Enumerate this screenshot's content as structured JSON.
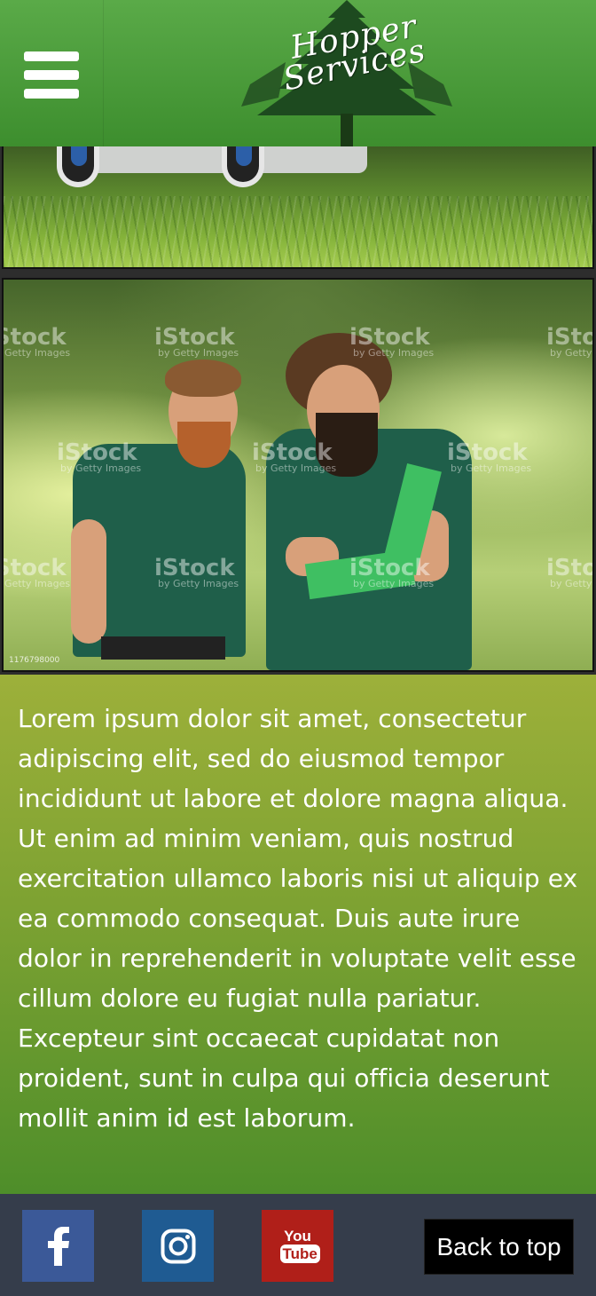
{
  "header": {
    "menu_icon": "hamburger-menu-icon",
    "logo": {
      "line1": "Hopper",
      "line2": "Services",
      "icon": "pine-tree-icon"
    }
  },
  "gallery": [
    {
      "subject": "lawn-mower-on-grass"
    },
    {
      "subject": "two-gardeners-with-clipboard",
      "watermark": "iStock",
      "watermark_sub": "by Getty Images",
      "stock_id": "1176798000"
    }
  ],
  "content": {
    "paragraph": "Lorem ipsum dolor sit amet, consectetur adipiscing elit, sed do eiusmod tempor incididunt ut labore et dolore magna aliqua. Ut enim ad minim veniam, quis nostrud exercitation ullamco laboris nisi ut aliquip ex ea commodo consequat. Duis aute irure dolor in reprehenderit in voluptate velit esse cillum dolore eu fugiat nulla pariatur. Excepteur sint occaecat cupidatat non proident, sunt in culpa qui officia deserunt mollit anim id est laborum."
  },
  "footer": {
    "social": [
      {
        "name": "facebook",
        "icon": "facebook-icon",
        "color": "#3b5998",
        "glyph": "f"
      },
      {
        "name": "instagram",
        "icon": "instagram-icon",
        "color": "#1f5b92"
      },
      {
        "name": "youtube",
        "icon": "youtube-icon",
        "color": "#b01f19",
        "top": "You",
        "bottom": "Tube"
      }
    ],
    "back_to_top": "Back to top"
  },
  "colors": {
    "header_green": "#4a9c3a",
    "text_section_top": "#9db03a",
    "text_section_bottom": "#4e8e2a",
    "footer_bg": "#353d4b"
  }
}
